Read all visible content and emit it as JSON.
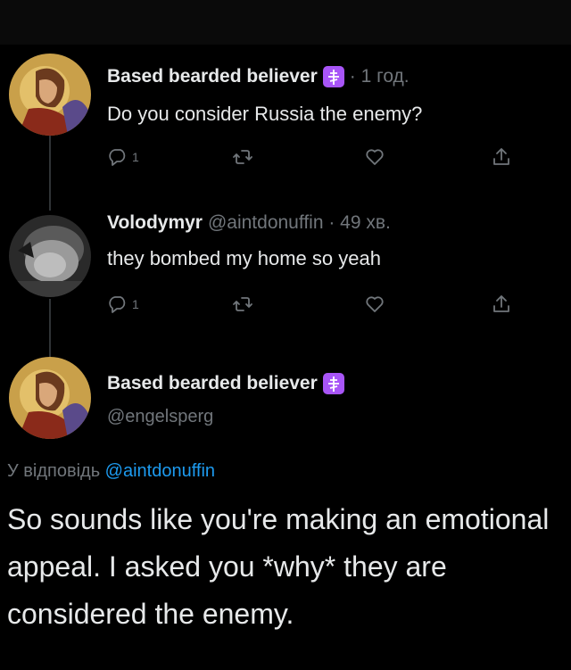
{
  "tweets": [
    {
      "author": "Based bearded believer",
      "meta": "· 1 год.",
      "text": "Do you consider Russia the enemy?",
      "reply_count": "1"
    },
    {
      "author": "Volodymyr",
      "meta": "@aintdonuffin · 49 хв.",
      "text": "they bombed my home so yeah",
      "reply_count": "1"
    }
  ],
  "focused": {
    "author": "Based bearded believer",
    "handle": "@engelsperg",
    "reply_prefix": "У відповідь ",
    "reply_handle": "@aintdonuffin",
    "text": "So sounds like you're making an emotional appeal. I asked you *why* they are considered the enemy."
  },
  "colors": {
    "background": "#000000",
    "muted": "#71767b",
    "link": "#1d9bf0",
    "badge": "#a855f7"
  },
  "icons": [
    "reply-icon",
    "retweet-icon",
    "like-icon",
    "share-icon",
    "orthodox-cross-icon"
  ]
}
